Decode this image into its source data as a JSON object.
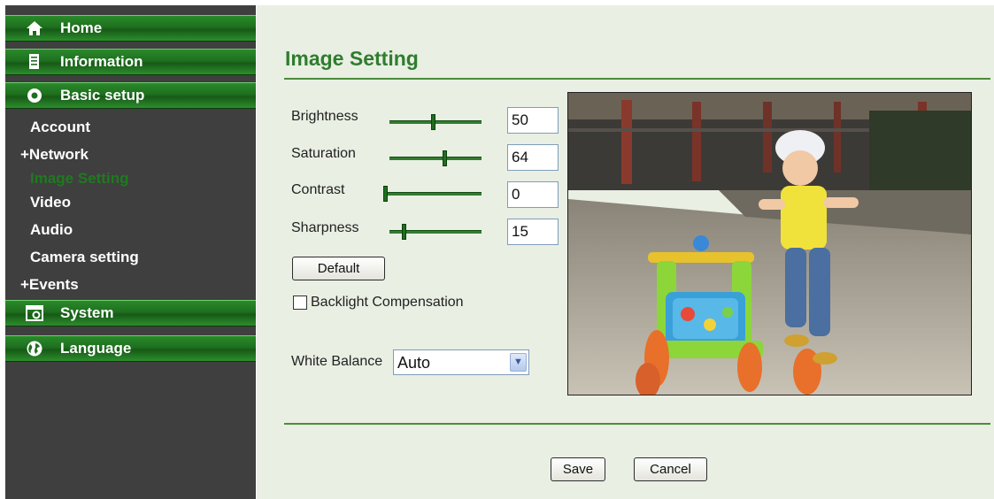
{
  "sidebar": {
    "home": "Home",
    "information": "Information",
    "basic_setup": "Basic setup",
    "sub_items": [
      {
        "label": "Account"
      },
      {
        "label": "+Network"
      },
      {
        "label": "Image Setting"
      },
      {
        "label": "Video"
      },
      {
        "label": "Audio"
      },
      {
        "label": "Camera setting"
      },
      {
        "label": "+Events"
      }
    ],
    "system": "System",
    "language": "Language",
    "icons": [
      "house-icon",
      "document-icon",
      "gear-icon",
      "camera-icon",
      "globe-icon"
    ],
    "active_color": "#1f7a1f"
  },
  "main": {
    "title": "Image Setting",
    "accent_color": "#2f7d2f",
    "sliders": [
      {
        "label": "Brightness",
        "value": "50",
        "level": 0.47
      },
      {
        "label": "Saturation",
        "value": "64",
        "level": 0.6
      },
      {
        "label": "Contrast",
        "value": "0",
        "level": 0.0
      },
      {
        "label": "Sharpness",
        "value": "15",
        "level": 0.15
      }
    ],
    "default_button": "Default",
    "backlight_label": "Backlight Compensation",
    "backlight_checked": false,
    "white_balance_label": "White Balance",
    "white_balance_value": "Auto",
    "save_button": "Save",
    "cancel_button": "Cancel"
  }
}
